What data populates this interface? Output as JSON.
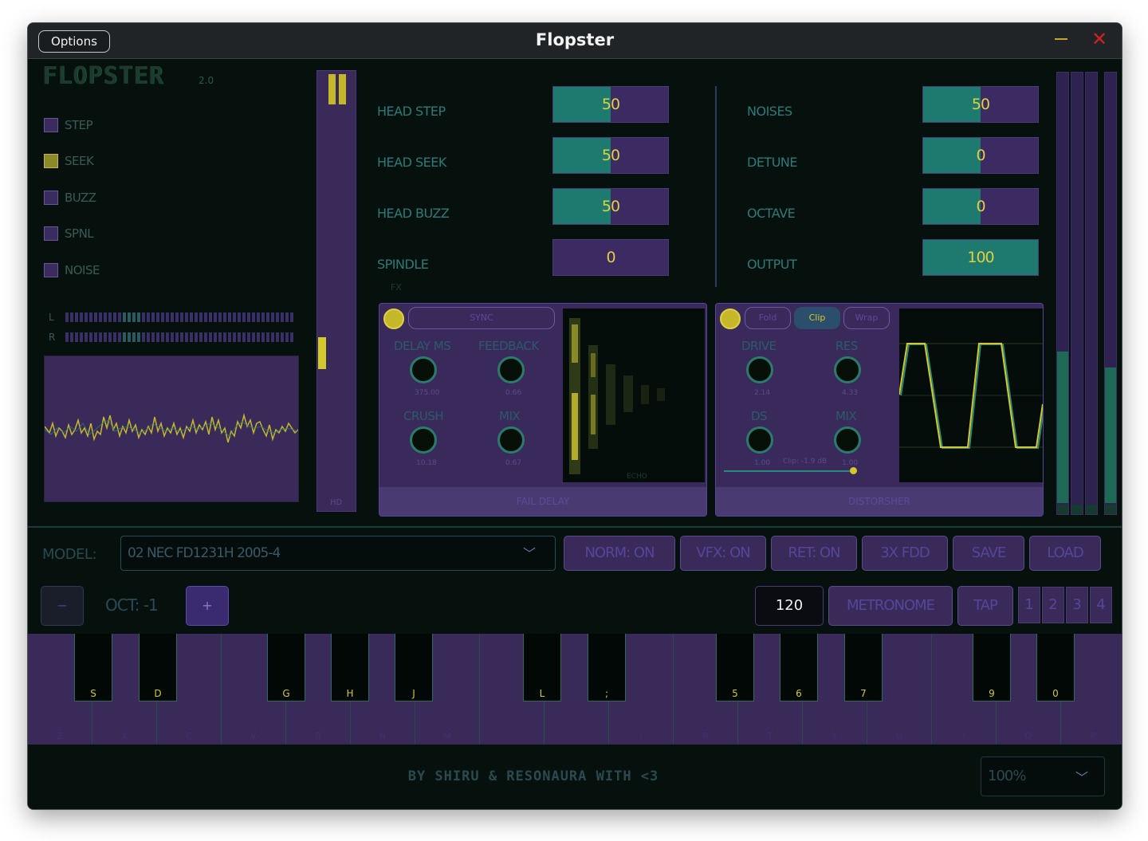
{
  "window": {
    "title": "Flopster",
    "options_label": "Options"
  },
  "logo": {
    "name": "FLOPSTER",
    "version": "2.0"
  },
  "toggles": [
    {
      "label": "STEP",
      "checked": false
    },
    {
      "label": "SEEK",
      "checked": true
    },
    {
      "label": "BUZZ",
      "checked": false
    },
    {
      "label": "SPNL",
      "checked": false
    },
    {
      "label": "NOISE",
      "checked": false
    }
  ],
  "meters": {
    "left_label": "L",
    "right_label": "R"
  },
  "hd_strip": {
    "label": "HD"
  },
  "params_left": [
    {
      "label": "HEAD STEP",
      "value": "50",
      "fill": 0.5
    },
    {
      "label": "HEAD SEEK",
      "value": "50",
      "fill": 0.5
    },
    {
      "label": "HEAD BUZZ",
      "value": "50",
      "fill": 0.5
    },
    {
      "label": "SPINDLE",
      "value": "0",
      "fill": 0.0
    }
  ],
  "params_right": [
    {
      "label": "NOISES",
      "value": "50",
      "fill": 0.5
    },
    {
      "label": "DETUNE",
      "value": "0",
      "fill": 0.5
    },
    {
      "label": "OCTAVE",
      "value": "0",
      "fill": 0.5
    },
    {
      "label": "OUTPUT",
      "value": "100",
      "fill": 1.0
    }
  ],
  "fx_tag": "FX",
  "delay_panel": {
    "sync_label": "SYNC",
    "knobs": [
      {
        "label": "DELAY MS",
        "value": "375.00"
      },
      {
        "label": "FEEDBACK",
        "value": "0.66"
      },
      {
        "label": "CRUSH",
        "value": "10.18"
      },
      {
        "label": "MIX",
        "value": "0.67"
      }
    ],
    "display_label": "ECHO",
    "footer": "FAIL DELAY"
  },
  "distortion_panel": {
    "modes": [
      "Fold",
      "Clip",
      "Wrap"
    ],
    "selected_mode": "Clip",
    "knobs": [
      {
        "label": "DRIVE",
        "value": "2.14"
      },
      {
        "label": "RES",
        "value": "4.33"
      },
      {
        "label": "DS",
        "value": "1.00"
      },
      {
        "label": "MIX",
        "value": "1.00"
      }
    ],
    "clip_readout": "Clip: -1.9 dB",
    "footer": "DISTORSHER"
  },
  "model": {
    "label": "MODEL:",
    "value": "02 NEC FD1231H 2005-4"
  },
  "toolbar": {
    "norm": "NORM: ON",
    "vfx": "VFX: ON",
    "ret": "RET: ON",
    "fdd": "3X FDD",
    "save": "SAVE",
    "load": "LOAD"
  },
  "octave": {
    "minus": "−",
    "label": "OCT: -1",
    "plus": "+"
  },
  "transport": {
    "bpm": "120",
    "metronome": "METRONOME",
    "tap": "TAP",
    "slots": [
      "1",
      "2",
      "3",
      "4"
    ]
  },
  "keyboard": {
    "white_keys": [
      "Z",
      "X",
      "C",
      "V",
      "B",
      "N",
      "M",
      ",",
      ".",
      "/",
      "R",
      "T",
      "Y",
      "U",
      "I",
      "O",
      "P"
    ],
    "black_keys": [
      "S",
      "D",
      "G",
      "H",
      "J",
      "L",
      ";",
      "5",
      "6",
      "7",
      "9",
      "0"
    ]
  },
  "footer": {
    "credit": "BY SHIRU & RESONAURA WITH <3",
    "zoom": "100%"
  },
  "colors": {
    "background": "#06110e",
    "panel_purple": "#3a2a5a",
    "accent_teal": "#1e7a6e",
    "accent_yellow": "#d4c82a"
  }
}
